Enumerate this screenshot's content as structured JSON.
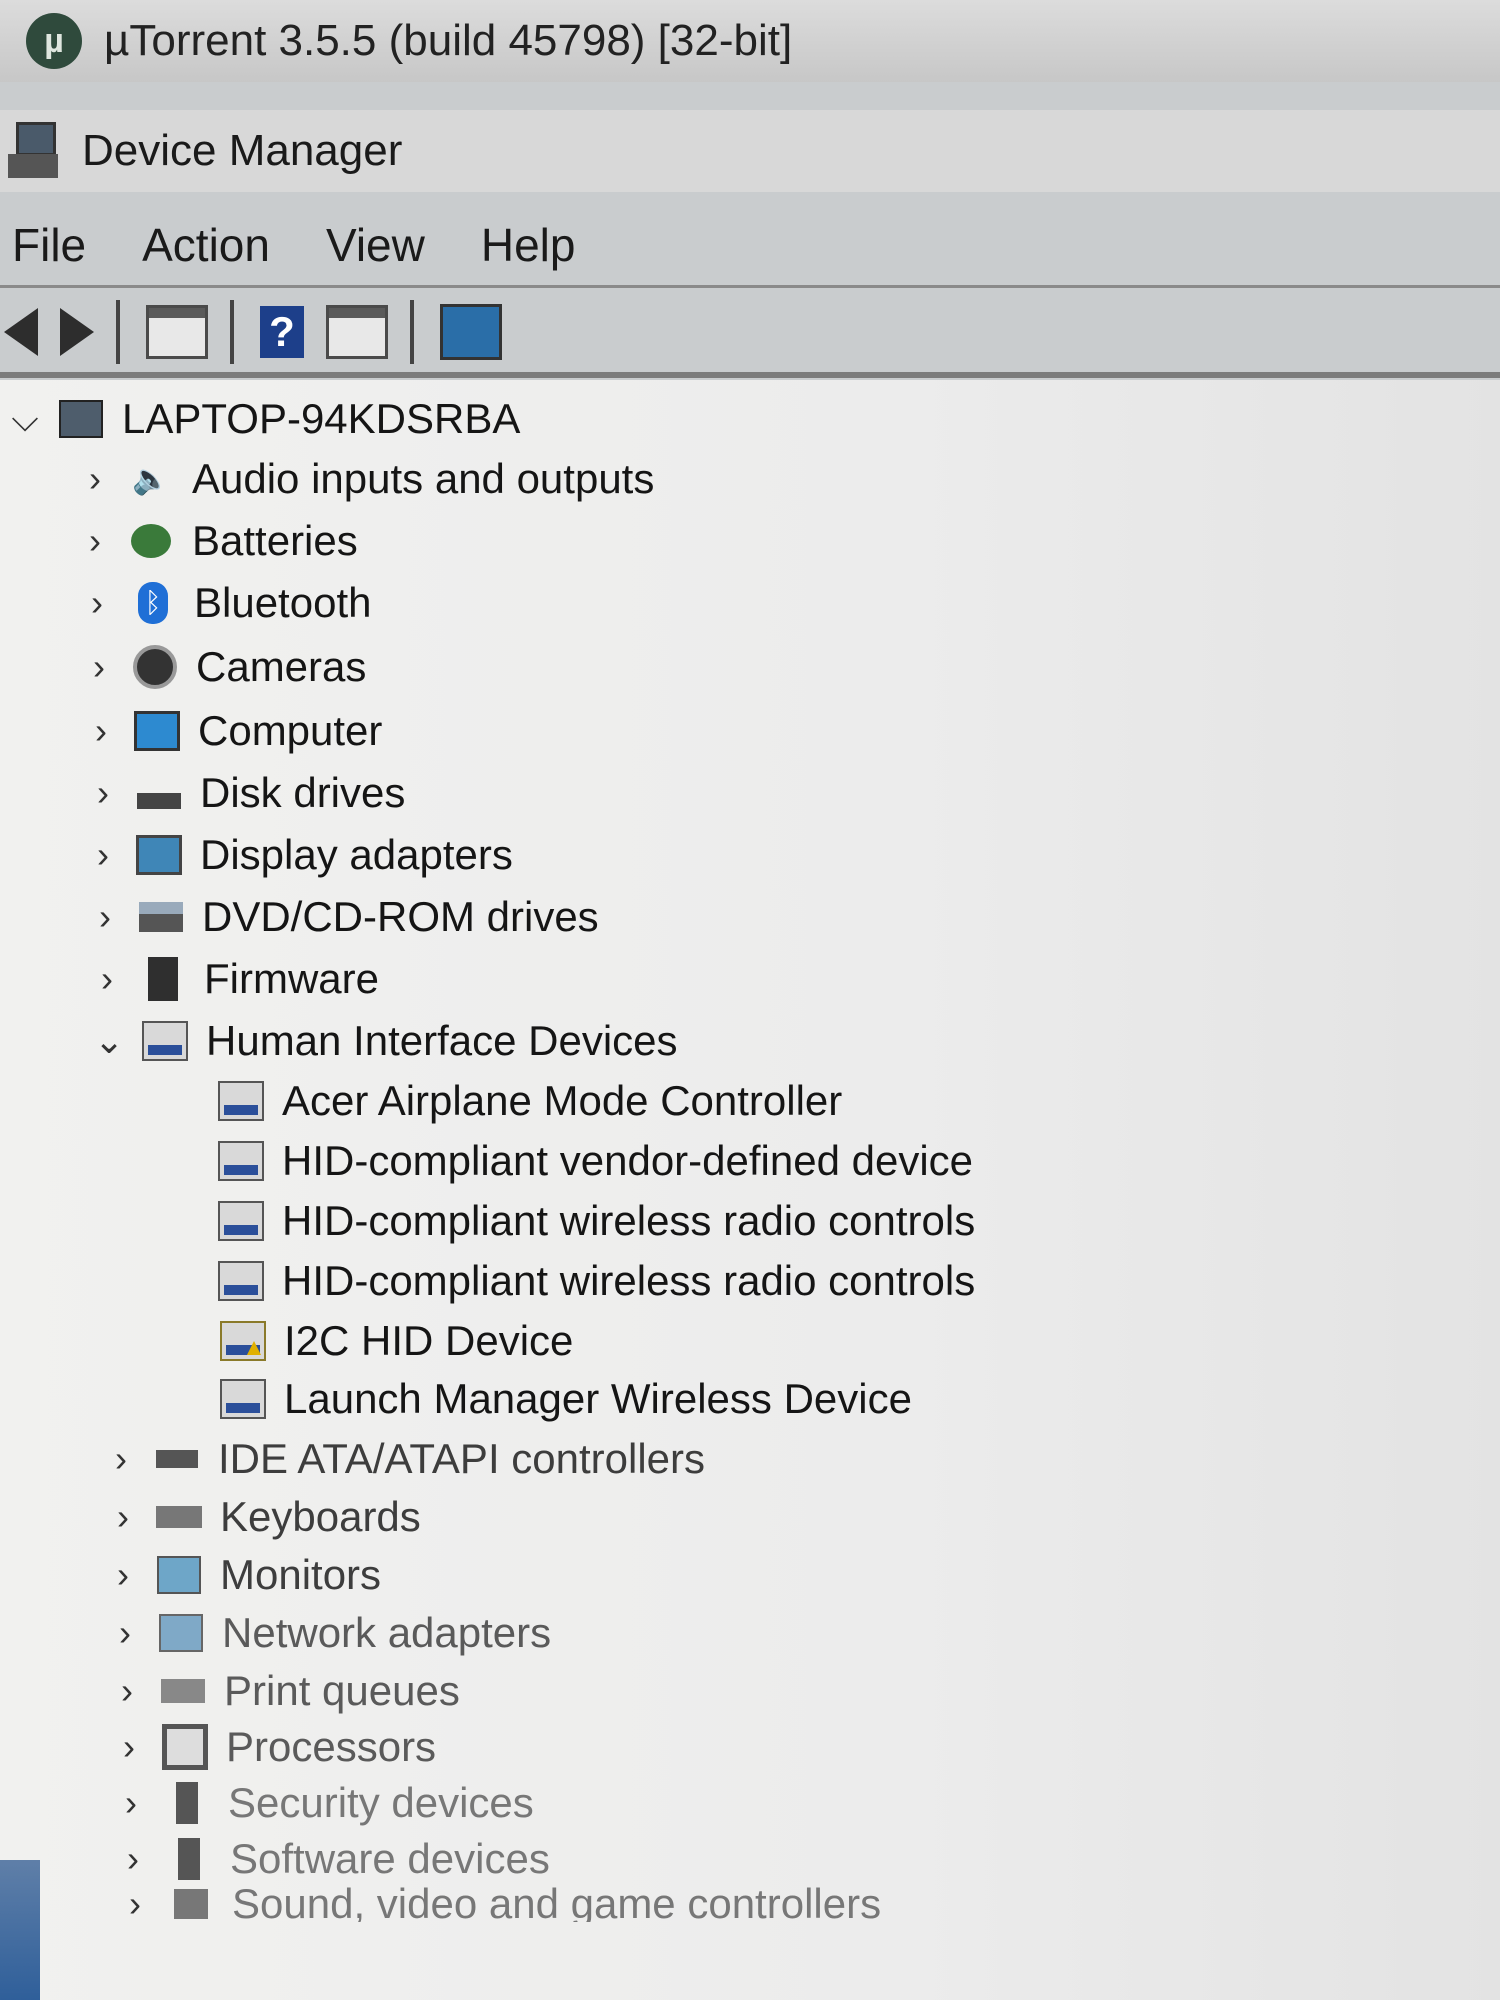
{
  "utorrent": {
    "title": "µTorrent 3.5.5  (build 45798) [32-bit]"
  },
  "window": {
    "title": "Device Manager"
  },
  "menu": [
    "File",
    "Action",
    "View",
    "Help"
  ],
  "toolbar": {
    "buttons": [
      "back-arrow-icon",
      "forward-arrow-icon",
      "properties-icon",
      "help-icon",
      "update-driver-icon",
      "scan-hardware-icon"
    ]
  },
  "tree": {
    "root": "LAPTOP-94KDSRBA",
    "categories": [
      {
        "label": "Audio inputs and outputs",
        "icon": "speaker-icon"
      },
      {
        "label": "Batteries",
        "icon": "battery-icon"
      },
      {
        "label": "Bluetooth",
        "icon": "bluetooth-icon"
      },
      {
        "label": "Cameras",
        "icon": "camera-icon"
      },
      {
        "label": "Computer",
        "icon": "computer-icon"
      },
      {
        "label": "Disk drives",
        "icon": "disk-drive-icon"
      },
      {
        "label": "Display adapters",
        "icon": "display-adapter-icon"
      },
      {
        "label": "DVD/CD-ROM drives",
        "icon": "dvd-drive-icon"
      },
      {
        "label": "Firmware",
        "icon": "firmware-icon"
      },
      {
        "label": "Human Interface Devices",
        "icon": "hid-icon",
        "expanded": true
      }
    ],
    "hid_children": [
      "Acer Airplane Mode Controller",
      "HID-compliant vendor-defined device",
      "HID-compliant wireless radio controls",
      "HID-compliant wireless radio controls",
      "I2C HID Device",
      "Launch Manager Wireless Device"
    ],
    "more_categories": [
      "IDE ATA/ATAPI controllers",
      "Keyboards",
      "Monitors",
      "Network adapters",
      "Print queues",
      "Processors",
      "Security devices",
      "Software devices",
      "Sound, video and game controllers"
    ]
  },
  "colors": {
    "accent": "#2b4f9a",
    "bluetooth": "#1f6fd6",
    "warning": "#e0b000"
  }
}
